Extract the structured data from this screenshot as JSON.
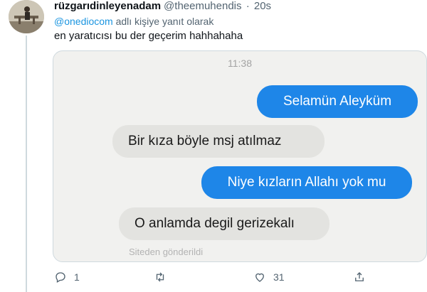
{
  "tweet": {
    "display_name": "rüzgarıdinleyenadam",
    "handle": "@theemuhendis",
    "separator": "·",
    "time": "20s",
    "reply_to": {
      "mention": "@onediocom",
      "suffix": " adlı kişiye yanıt olarak"
    },
    "text": "en yaratıcısı bu der geçerim hahhahaha"
  },
  "screenshot": {
    "time": "11:38",
    "messages": [
      {
        "direction": "out",
        "text": "Selamün Aleyküm"
      },
      {
        "direction": "in",
        "text": "Bir kıza böyle msj atılmaz"
      },
      {
        "direction": "out",
        "text": "Niye kızların Allahı yok mu"
      },
      {
        "direction": "in",
        "text": "O anlamda  degil gerizekalı"
      }
    ],
    "sent_via": "Siteden gönderildi"
  },
  "actions": {
    "reply_count": "1",
    "retweet_count": "",
    "like_count": "31",
    "icons": [
      "reply-icon",
      "retweet-icon",
      "like-icon",
      "share-icon"
    ]
  },
  "colors": {
    "link": "#1b95e0",
    "outgoing_bubble": "#1e86e8",
    "incoming_bubble": "#e3e3e0"
  }
}
